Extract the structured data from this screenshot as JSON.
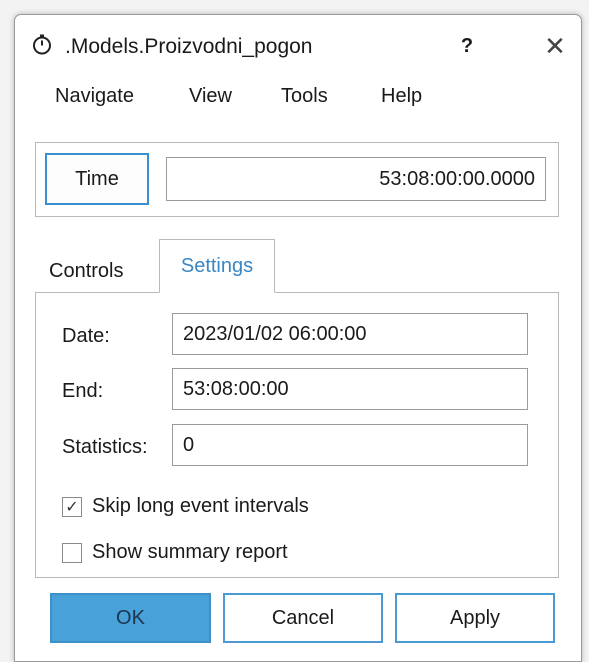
{
  "window": {
    "title": ".Models.Proizvodni_pogon",
    "help_label": "?",
    "close_label": "✕"
  },
  "menu": {
    "items": [
      "Navigate",
      "View",
      "Tools",
      "Help"
    ]
  },
  "time": {
    "button_label": "Time",
    "value": "53:08:00:00.0000"
  },
  "tabs": {
    "controls": "Controls",
    "settings": "Settings",
    "active": "Settings"
  },
  "settings": {
    "date_label": "Date:",
    "date_value": "2023/01/02 06:00:00",
    "end_label": "End:",
    "end_value": "53:08:00:00",
    "statistics_label": "Statistics:",
    "statistics_value": "0",
    "skip_long_label": "Skip long event intervals",
    "skip_long_checked": true,
    "show_summary_label": "Show summary report",
    "show_summary_checked": false,
    "check_glyph": "✓"
  },
  "buttons": {
    "ok": "OK",
    "cancel": "Cancel",
    "apply": "Apply"
  },
  "colors": {
    "accent": "#3a8fd1",
    "ok_fill": "#48a1d8",
    "active_tab_text": "#3a87c4"
  },
  "icons": {
    "app": "stopwatch-icon",
    "close": "close-icon",
    "help": "help-icon",
    "check": "checkmark-icon"
  }
}
